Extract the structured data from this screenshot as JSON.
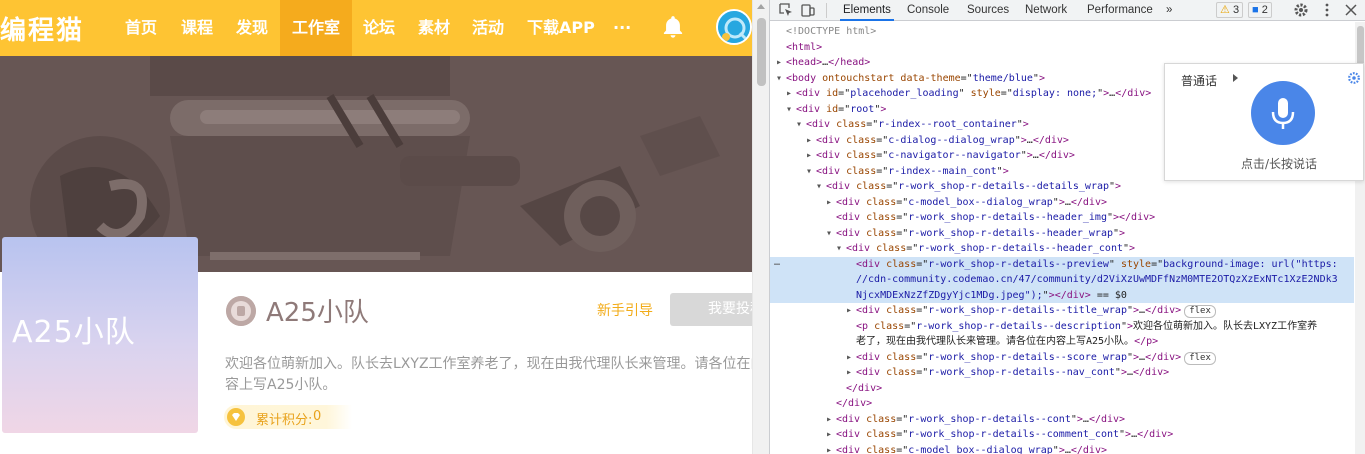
{
  "site": {
    "logo": "编程猫",
    "nav": [
      {
        "label": "首页",
        "active": false
      },
      {
        "label": "课程",
        "active": false
      },
      {
        "label": "发现",
        "active": false
      },
      {
        "label": "工作室",
        "active": true
      },
      {
        "label": "论坛",
        "active": false
      },
      {
        "label": "素材",
        "active": false
      },
      {
        "label": "活动",
        "active": false
      },
      {
        "label": "下载APP",
        "active": false
      },
      {
        "label": "···",
        "active": false
      }
    ],
    "bell_icon": "bell-icon",
    "cover_text": "A25小队",
    "title": "A25小队",
    "guide_link": "新手引导",
    "submit_button": "我要投稿",
    "description": "欢迎各位萌新加入。队长去LXYZ工作室养老了，现在由我代理队长来管理。请各位在内容上写A25小队。",
    "score_label": "累计积分:",
    "score_value": "0",
    "colors": {
      "nav_bg": "#fec433",
      "nav_active": "#f5ab1d",
      "accent": "#f2ac1a",
      "banner": "#6b5a56"
    }
  },
  "devtools": {
    "tabs": [
      "Elements",
      "Console",
      "Sources",
      "Network",
      "Performance",
      "»"
    ],
    "active_tab": "Elements",
    "warnings": "3",
    "messages": "2",
    "lines": [
      {
        "indent": 0,
        "tri": "",
        "html": "<span class='cmt'>&lt;!DOCTYPE html&gt;</span>"
      },
      {
        "indent": 0,
        "tri": "",
        "html": "<span class='tag'>&lt;html&gt;</span>"
      },
      {
        "indent": 0,
        "tri": "▶",
        "html": "<span class='tag'>&lt;head&gt;</span>…<span class='tag'>&lt;/head&gt;</span>"
      },
      {
        "indent": 0,
        "tri": "▼",
        "html": "<span class='tag'>&lt;body</span> <span class='attr'>ontouchstart</span> <span class='attr'>data-theme</span>=\"<span class='val'>theme/blue</span>\"<span class='tag'>&gt;</span>"
      },
      {
        "indent": 1,
        "tri": "▶",
        "html": "<span class='tag'>&lt;div</span> <span class='attr'>id</span>=\"<span class='val'>placehoder_loading</span>\" <span class='attr'>style</span>=\"<span class='val'>display: none;</span>\"<span class='tag'>&gt;</span>…<span class='tag'>&lt;/div&gt;</span>"
      },
      {
        "indent": 1,
        "tri": "▼",
        "html": "<span class='tag'>&lt;div</span> <span class='attr'>id</span>=\"<span class='val'>root</span>\"<span class='tag'>&gt;</span>"
      },
      {
        "indent": 2,
        "tri": "▼",
        "html": "<span class='tag'>&lt;div</span> <span class='attr'>class</span>=\"<span class='val'>r-index--root_container</span>\"<span class='tag'>&gt;</span>"
      },
      {
        "indent": 3,
        "tri": "▶",
        "html": "<span class='tag'>&lt;div</span> <span class='attr'>class</span>=\"<span class='val'>c-dialog--dialog_wrap</span>\"<span class='tag'>&gt;</span>…<span class='tag'>&lt;/div&gt;</span>"
      },
      {
        "indent": 3,
        "tri": "▶",
        "html": "<span class='tag'>&lt;div</span> <span class='attr'>class</span>=\"<span class='val'>c-navigator--navigator</span>\"<span class='tag'>&gt;</span>…<span class='tag'>&lt;/div&gt;</span>"
      },
      {
        "indent": 3,
        "tri": "▼",
        "html": "<span class='tag'>&lt;div</span> <span class='attr'>class</span>=\"<span class='val'>r-index--main_cont</span>\"<span class='tag'>&gt;</span>"
      },
      {
        "indent": 4,
        "tri": "▼",
        "html": "<span class='tag'>&lt;div</span> <span class='attr'>class</span>=\"<span class='val'>r-work_shop-r-details--details_wrap</span>\"<span class='tag'>&gt;</span>"
      },
      {
        "indent": 5,
        "tri": "▶",
        "html": "<span class='tag'>&lt;div</span> <span class='attr'>class</span>=\"<span class='val'>c-model_box--dialog_wrap</span>\"<span class='tag'>&gt;</span>…<span class='tag'>&lt;/div&gt;</span>"
      },
      {
        "indent": 5,
        "tri": "",
        "html": "<span class='tag'>&lt;div</span> <span class='attr'>class</span>=\"<span class='val'>r-work_shop-r-details--header_img</span>\"<span class='tag'>&gt;&lt;/div&gt;</span>"
      },
      {
        "indent": 5,
        "tri": "▼",
        "html": "<span class='tag'>&lt;div</span> <span class='attr'>class</span>=\"<span class='val'>r-work_shop-r-details--header_wrap</span>\"<span class='tag'>&gt;</span>"
      },
      {
        "indent": 6,
        "tri": "▼",
        "html": "<span class='tag'>&lt;div</span> <span class='attr'>class</span>=\"<span class='val'>r-work_shop-r-details--header_cont</span>\"<span class='tag'>&gt;</span>"
      },
      {
        "indent": 7,
        "tri": "",
        "sel": true,
        "html": "<span class='tag'>&lt;div</span> <span class='attr'>class</span>=\"<span class='val'>r-work_shop-r-details--preview</span>\" <span class='attr'>style</span>=\"<span class='val'>background-image: url(\"https:</span>"
      },
      {
        "indent": 7,
        "tri": "",
        "sel": true,
        "html": "<span class='val'>//cdn-community.codemao.cn/47/community/d2ViXzUwMDFfNzM0MTE2OTQzXzExNTc1XzE2NDk3</span>"
      },
      {
        "indent": 7,
        "tri": "",
        "sel": true,
        "html": "<span class='val'>NjcxMDExNzZfZDgyYjc1MDg.jpeg\");</span>\"<span class='tag'>&gt;&lt;/div&gt;</span> == $0"
      },
      {
        "indent": 7,
        "tri": "▶",
        "html": "<span class='tag'>&lt;div</span> <span class='attr'>class</span>=\"<span class='val'>r-work_shop-r-details--title_wrap</span>\"<span class='tag'>&gt;</span>…<span class='tag'>&lt;/div&gt;</span><span class='flexbadge'>flex</span>"
      },
      {
        "indent": 7,
        "tri": "",
        "html": "<span class='tag'>&lt;p</span> <span class='attr'>class</span>=\"<span class='val'>r-work_shop-r-details--description</span>\"<span class='tag'>&gt;</span><span class='txt'>欢迎各位萌新加入。队长去LXYZ工作室养</span>"
      },
      {
        "indent": 7,
        "tri": "",
        "html": "<span class='txt'>老了，现在由我代理队长来管理。请各位在内容上写A25小队。</span><span class='tag'>&lt;/p&gt;</span>"
      },
      {
        "indent": 7,
        "tri": "▶",
        "html": "<span class='tag'>&lt;div</span> <span class='attr'>class</span>=\"<span class='val'>r-work_shop-r-details--score_wrap</span>\"<span class='tag'>&gt;</span>…<span class='tag'>&lt;/div&gt;</span><span class='flexbadge'>flex</span>"
      },
      {
        "indent": 7,
        "tri": "▶",
        "html": "<span class='tag'>&lt;div</span> <span class='attr'>class</span>=\"<span class='val'>r-work_shop-r-details--nav_cont</span>\"<span class='tag'>&gt;</span>…<span class='tag'>&lt;/div&gt;</span>"
      },
      {
        "indent": 6,
        "tri": "",
        "html": "<span class='tag'>&lt;/div&gt;</span>"
      },
      {
        "indent": 5,
        "tri": "",
        "html": "<span class='tag'>&lt;/div&gt;</span>"
      },
      {
        "indent": 5,
        "tri": "▶",
        "html": "<span class='tag'>&lt;div</span> <span class='attr'>class</span>=\"<span class='val'>r-work_shop-r-details--cont</span>\"<span class='tag'>&gt;</span>…<span class='tag'>&lt;/div&gt;</span>"
      },
      {
        "indent": 5,
        "tri": "▶",
        "html": "<span class='tag'>&lt;div</span> <span class='attr'>class</span>=\"<span class='val'>r-work_shop-r-details--comment_cont</span>\"<span class='tag'>&gt;</span>…<span class='tag'>&lt;/div&gt;</span>"
      },
      {
        "indent": 5,
        "tri": "▶",
        "html": "<span class='tag'>&lt;div</span> <span class='attr'>class</span>=\"<span class='val'>c-model_box--dialog_wrap</span>\"<span class='tag'>&gt;</span>…<span class='tag'>&lt;/div&gt;</span>"
      }
    ]
  },
  "voice_panel": {
    "language": "普通话",
    "hint": "点击/长按说话",
    "mic_icon": "microphone-icon",
    "settings_icon": "gear-icon"
  }
}
